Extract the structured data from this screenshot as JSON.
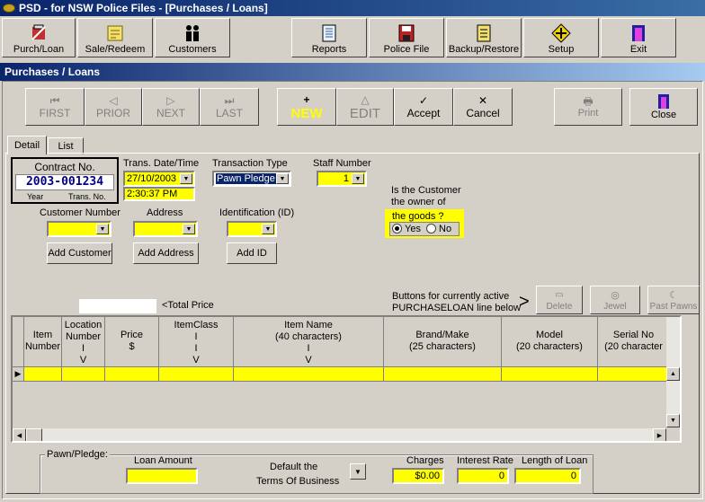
{
  "window": {
    "title": "PSD - for NSW Police Files - [Purchases / Loans]"
  },
  "toolbar": {
    "purch_loan": "Purch/Loan",
    "sale_redeem": "Sale/Redeem",
    "customers": "Customers",
    "reports": "Reports",
    "police_file": "Police File",
    "backup_restore": "Backup/Restore",
    "setup": "Setup",
    "exit": "Exit"
  },
  "form": {
    "title": "Purchases / Loans"
  },
  "nav": {
    "first": "FIRST",
    "prior": "PRIOR",
    "next": "NEXT",
    "last": "LAST",
    "new": "NEW",
    "edit": "EDIT",
    "accept": "Accept",
    "cancel": "Cancel",
    "print": "Print",
    "close": "Close"
  },
  "tabs": {
    "detail": "Detail",
    "list": "List"
  },
  "contract": {
    "label": "Contract No.",
    "value": "2003-001234",
    "year_label": "Year",
    "trans_label": "Trans. No."
  },
  "trans_date": {
    "label": "Trans. Date/Time",
    "date": "27/10/2003",
    "time": "2:30:37 PM"
  },
  "transaction_type": {
    "label": "Transaction Type",
    "value": "Pawn Pledge"
  },
  "staff_number": {
    "label": "Staff Number",
    "value": "1"
  },
  "owner_question": {
    "line1": "Is the Customer",
    "line2": "the owner of",
    "line3": "the goods ?",
    "yes": "Yes",
    "no": "No",
    "selected": "Yes"
  },
  "customer_number": {
    "label": "Customer Number",
    "button": "Add Customer"
  },
  "address": {
    "label": "Address",
    "button": "Add Address"
  },
  "identification": {
    "label": "Identification (ID)",
    "button": "Add ID"
  },
  "total_price": {
    "label": "<Total Price",
    "value": ""
  },
  "line_buttons": {
    "caption1": "Buttons for currently active",
    "caption2": "PURCHASELOAN line below",
    "arrow": ">",
    "delete": "Delete",
    "jewel": "Jewel",
    "past_pawns": "Past Pawns"
  },
  "grid": {
    "columns": [
      "Item\nNumber",
      "Location\nNumber\nI\nV",
      "Price\n$",
      "ItemClass\nI\nI\nV",
      "Item Name\n(40 characters)\nI\nV",
      "Brand/Make\n(25 characters)",
      "Model\n(20 characters)",
      "Serial No\n(20 character"
    ],
    "row_indicator": "▶"
  },
  "pawn": {
    "group_label": "Pawn/Pledge:",
    "loan_amount_label": "Loan Amount",
    "loan_amount": "",
    "default_terms_line1": "Default the",
    "default_terms_line2": "Terms Of Business",
    "charges_label": "Charges",
    "charges": "$0.00",
    "interest_label": "Interest Rate",
    "interest": "0",
    "length_label": "Length of Loan",
    "length": "0"
  }
}
